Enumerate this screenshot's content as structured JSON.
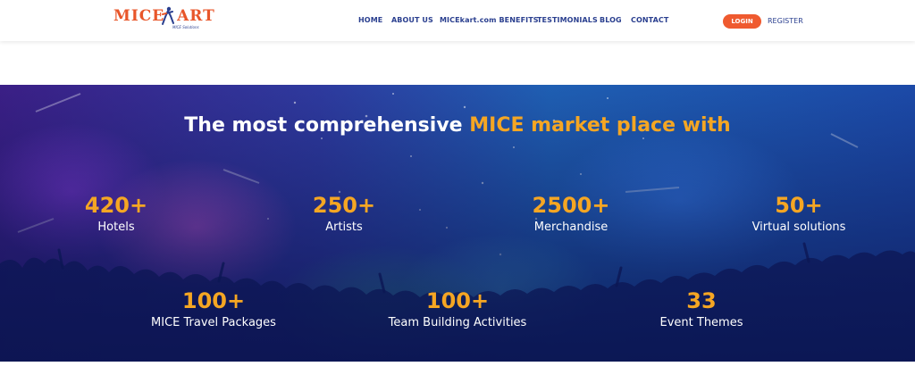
{
  "brand": {
    "logo_text": "MICE KART",
    "logo_tagline": "MICE Solutions"
  },
  "nav": {
    "items": [
      {
        "label": "HOME"
      },
      {
        "label": "ABOUT US"
      },
      {
        "label": "MICEkart.com BENEFITS"
      },
      {
        "label": "TESTIMONIALS"
      },
      {
        "label": "BLOG"
      },
      {
        "label": "CONTACT"
      }
    ],
    "login_label": "LOGIN",
    "register_label": "REGISTER"
  },
  "hero": {
    "title_part1": "The most comprehensive ",
    "title_accent": "MICE market place with",
    "stats": [
      {
        "number": "420+",
        "label": "Hotels"
      },
      {
        "number": "250+",
        "label": "Artists"
      },
      {
        "number": "2500+",
        "label": "Merchandise"
      },
      {
        "number": "50+",
        "label": "Virtual solutions"
      },
      {
        "number": "100+",
        "label": "MICE Travel Packages"
      },
      {
        "number": "100+",
        "label": "Team Building Activities"
      },
      {
        "number": "33",
        "label": "Event Themes"
      }
    ]
  },
  "colors": {
    "accent": "#f5a623",
    "brand_orange": "#ef5a2f",
    "nav_blue": "#2a3f8f"
  }
}
